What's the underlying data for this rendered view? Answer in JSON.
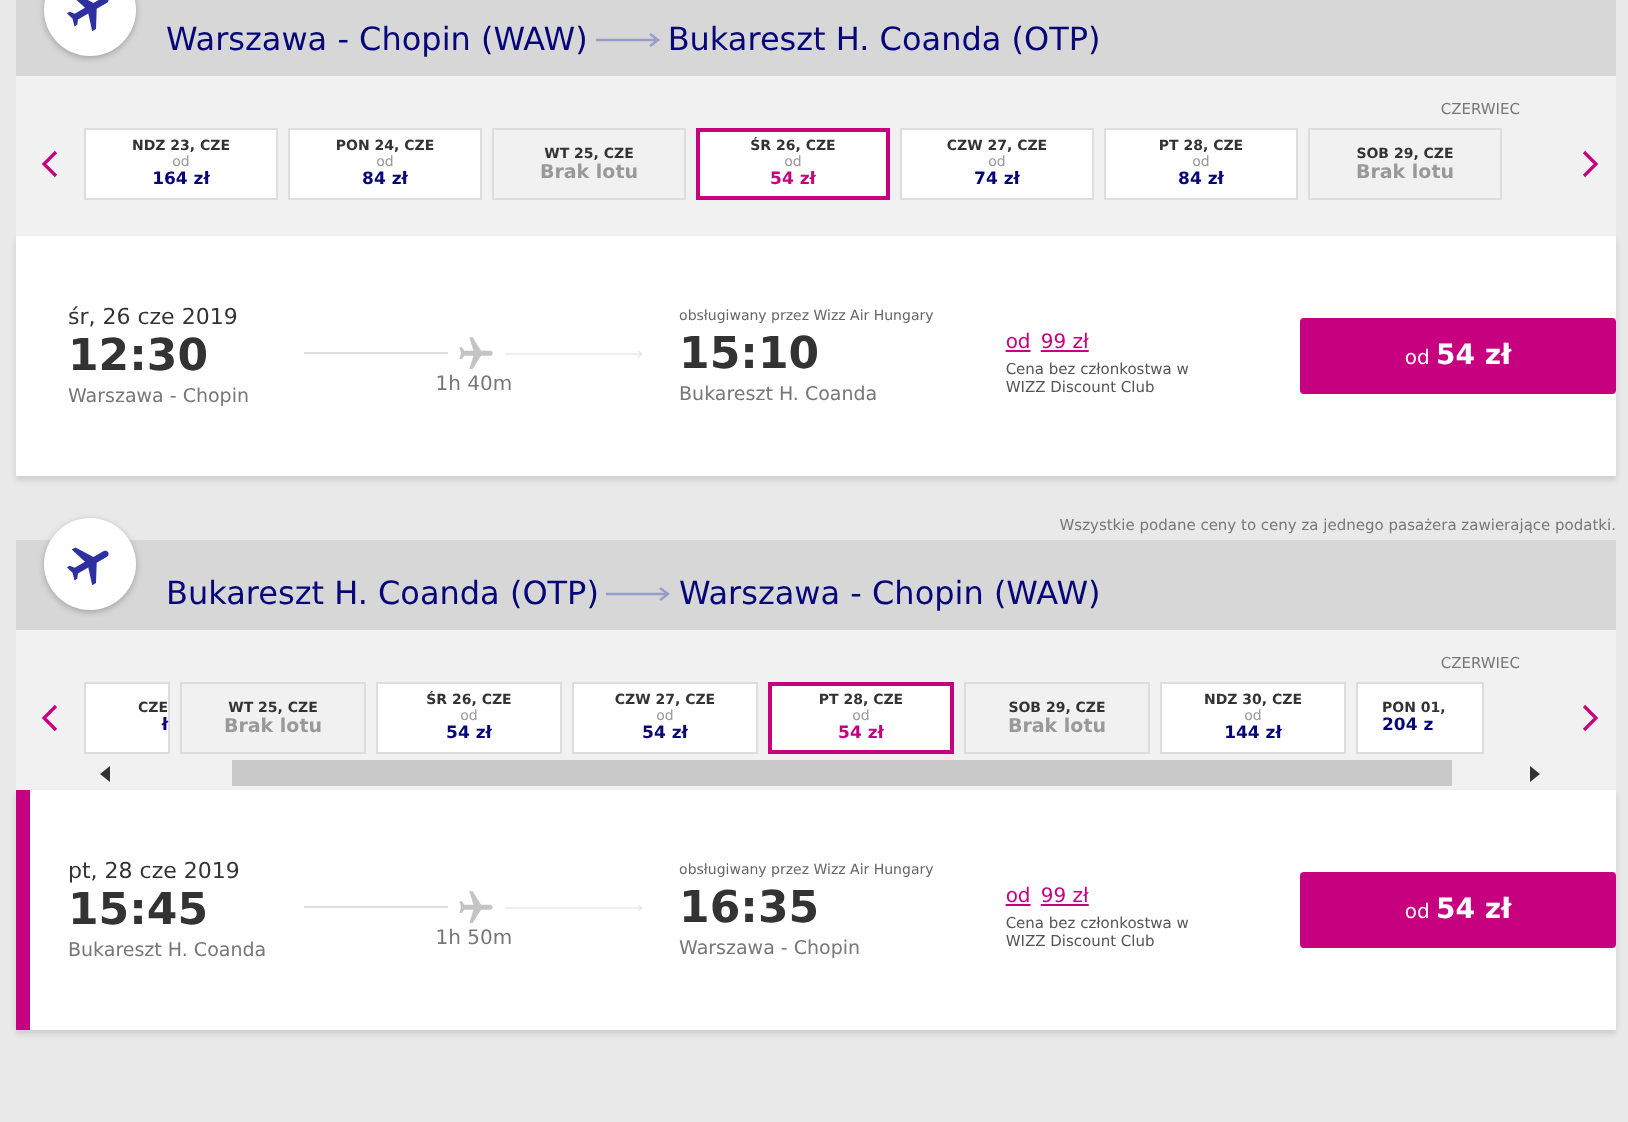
{
  "sections": [
    {
      "origin": "Warszawa - Chopin (WAW)",
      "destination": "Bukareszt H. Coanda (OTP)",
      "month": "CZERWIEC",
      "days": [
        {
          "label": "NDZ 23, CZE",
          "from": "od",
          "price": "164 zł",
          "kind": "fare",
          "selected": false
        },
        {
          "label": "PON 24, CZE",
          "from": "od",
          "price": "84 zł",
          "kind": "fare",
          "selected": false
        },
        {
          "label": "WT 25, CZE",
          "price": "Brak lotu",
          "kind": "none",
          "selected": false
        },
        {
          "label": "ŚR 26, CZE",
          "from": "od",
          "price": "54 zł",
          "kind": "fare",
          "selected": true
        },
        {
          "label": "CZW 27, CZE",
          "from": "od",
          "price": "74 zł",
          "kind": "fare",
          "selected": false
        },
        {
          "label": "PT 28, CZE",
          "from": "od",
          "price": "84 zł",
          "kind": "fare",
          "selected": false
        },
        {
          "label": "SOB 29, CZE",
          "price": "Brak lotu",
          "kind": "none",
          "selected": false
        }
      ],
      "flight": {
        "selected": false,
        "date": "śr, 26 cze 2019",
        "dep_time": "12:30",
        "dep_city": "Warszawa - Chopin",
        "duration": "1h 40m",
        "operator": "obsługiwany przez Wizz Air Hungary",
        "arr_time": "15:10",
        "arr_city": "Bukareszt H. Coanda",
        "club_from": "od",
        "club_price": "99 zł",
        "club_note": "Cena bez członkostwa w WIZZ Discount Club",
        "button": "od **54 zł**"
      }
    },
    {
      "notice": "Wszystkie podane ceny to ceny za jednego pasażera zawierające podatki.",
      "origin": "Bukareszt H. Coanda (OTP)",
      "destination": "Warszawa - Chopin (WAW)",
      "month": "CZERWIEC",
      "scrollbar": true,
      "days": [
        {
          "label": "CZE",
          "price": "ł",
          "kind": "partial",
          "selected": false
        },
        {
          "label": "WT 25, CZE",
          "price": "Brak lotu",
          "kind": "none",
          "selected": false
        },
        {
          "label": "ŚR 26, CZE",
          "from": "od",
          "price": "54 zł",
          "kind": "fare",
          "selected": false
        },
        {
          "label": "CZW 27, CZE",
          "from": "od",
          "price": "54 zł",
          "kind": "fare",
          "selected": false
        },
        {
          "label": "PT 28, CZE",
          "from": "od",
          "price": "54 zł",
          "kind": "fare",
          "selected": true
        },
        {
          "label": "SOB 29, CZE",
          "price": "Brak lotu",
          "kind": "none",
          "selected": false
        },
        {
          "label": "NDZ 30, CZE",
          "from": "od",
          "price": "144 zł",
          "kind": "fare",
          "selected": false
        },
        {
          "label": "PON 01,",
          "price": "204 z",
          "kind": "partial",
          "selected": false
        }
      ],
      "flight": {
        "selected": true,
        "date": "pt, 28 cze 2019",
        "dep_time": "15:45",
        "dep_city": "Bukareszt H. Coanda",
        "duration": "1h 50m",
        "operator": "obsługiwany przez Wizz Air Hungary",
        "arr_time": "16:35",
        "arr_city": "Warszawa - Chopin",
        "club_from": "od",
        "club_price": "99 zł",
        "club_note": "Cena bez członkostwa w WIZZ Discount Club",
        "button": "od **54 zł**"
      }
    }
  ]
}
